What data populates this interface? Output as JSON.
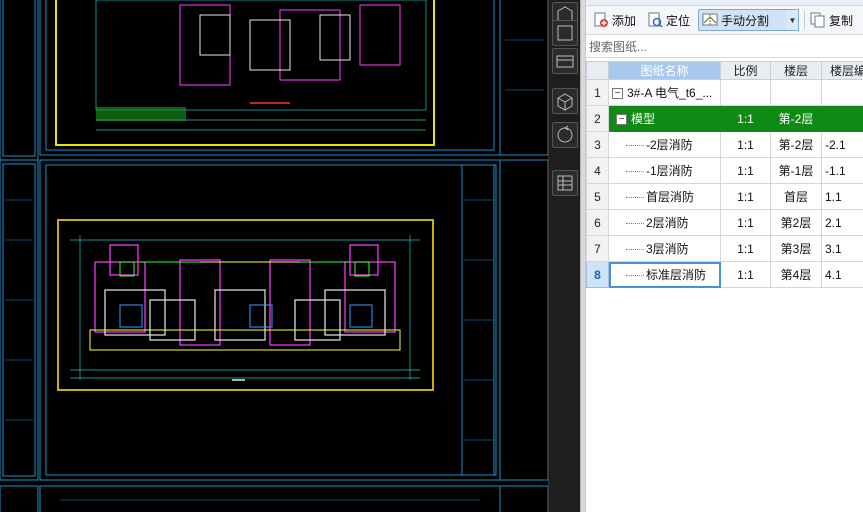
{
  "toolbar": {
    "add_label": "添加",
    "locate_label": "定位",
    "split_label": "手动分割",
    "copy_label": "复制"
  },
  "search": {
    "placeholder": "搜索图纸..."
  },
  "table": {
    "headers": [
      "图纸名称",
      "比例",
      "楼层",
      "楼层编号"
    ],
    "rows": [
      {
        "num": "1",
        "name": "3#-A 电气_t6_...",
        "scale": "",
        "floor": "",
        "code": "",
        "expander": "−",
        "level": 0
      },
      {
        "num": "2",
        "name": "模型",
        "scale": "1:1",
        "floor": "第-2层",
        "code": "",
        "expander": "−",
        "level": 1
      },
      {
        "num": "3",
        "name": "-2层消防",
        "scale": "1:1",
        "floor": "第-2层",
        "code": "-2.1",
        "level": 2
      },
      {
        "num": "4",
        "name": "-1层消防",
        "scale": "1:1",
        "floor": "第-1层",
        "code": "-1.1",
        "level": 2
      },
      {
        "num": "5",
        "name": "首层消防",
        "scale": "1:1",
        "floor": "首层",
        "code": "1.1",
        "level": 2
      },
      {
        "num": "6",
        "name": "2层消防",
        "scale": "1:1",
        "floor": "第2层",
        "code": "2.1",
        "level": 2
      },
      {
        "num": "7",
        "name": "3层消防",
        "scale": "1:1",
        "floor": "第3层",
        "code": "3.1",
        "level": 2
      },
      {
        "num": "8",
        "name": "标准层消防",
        "scale": "1:1",
        "floor": "第4层",
        "code": "4.1",
        "level": 2
      }
    ]
  },
  "colors": {
    "highlight_row": "#0f8a14",
    "cad_frame": "#1e90c8",
    "cad_border_yellow": "#e6e600"
  }
}
